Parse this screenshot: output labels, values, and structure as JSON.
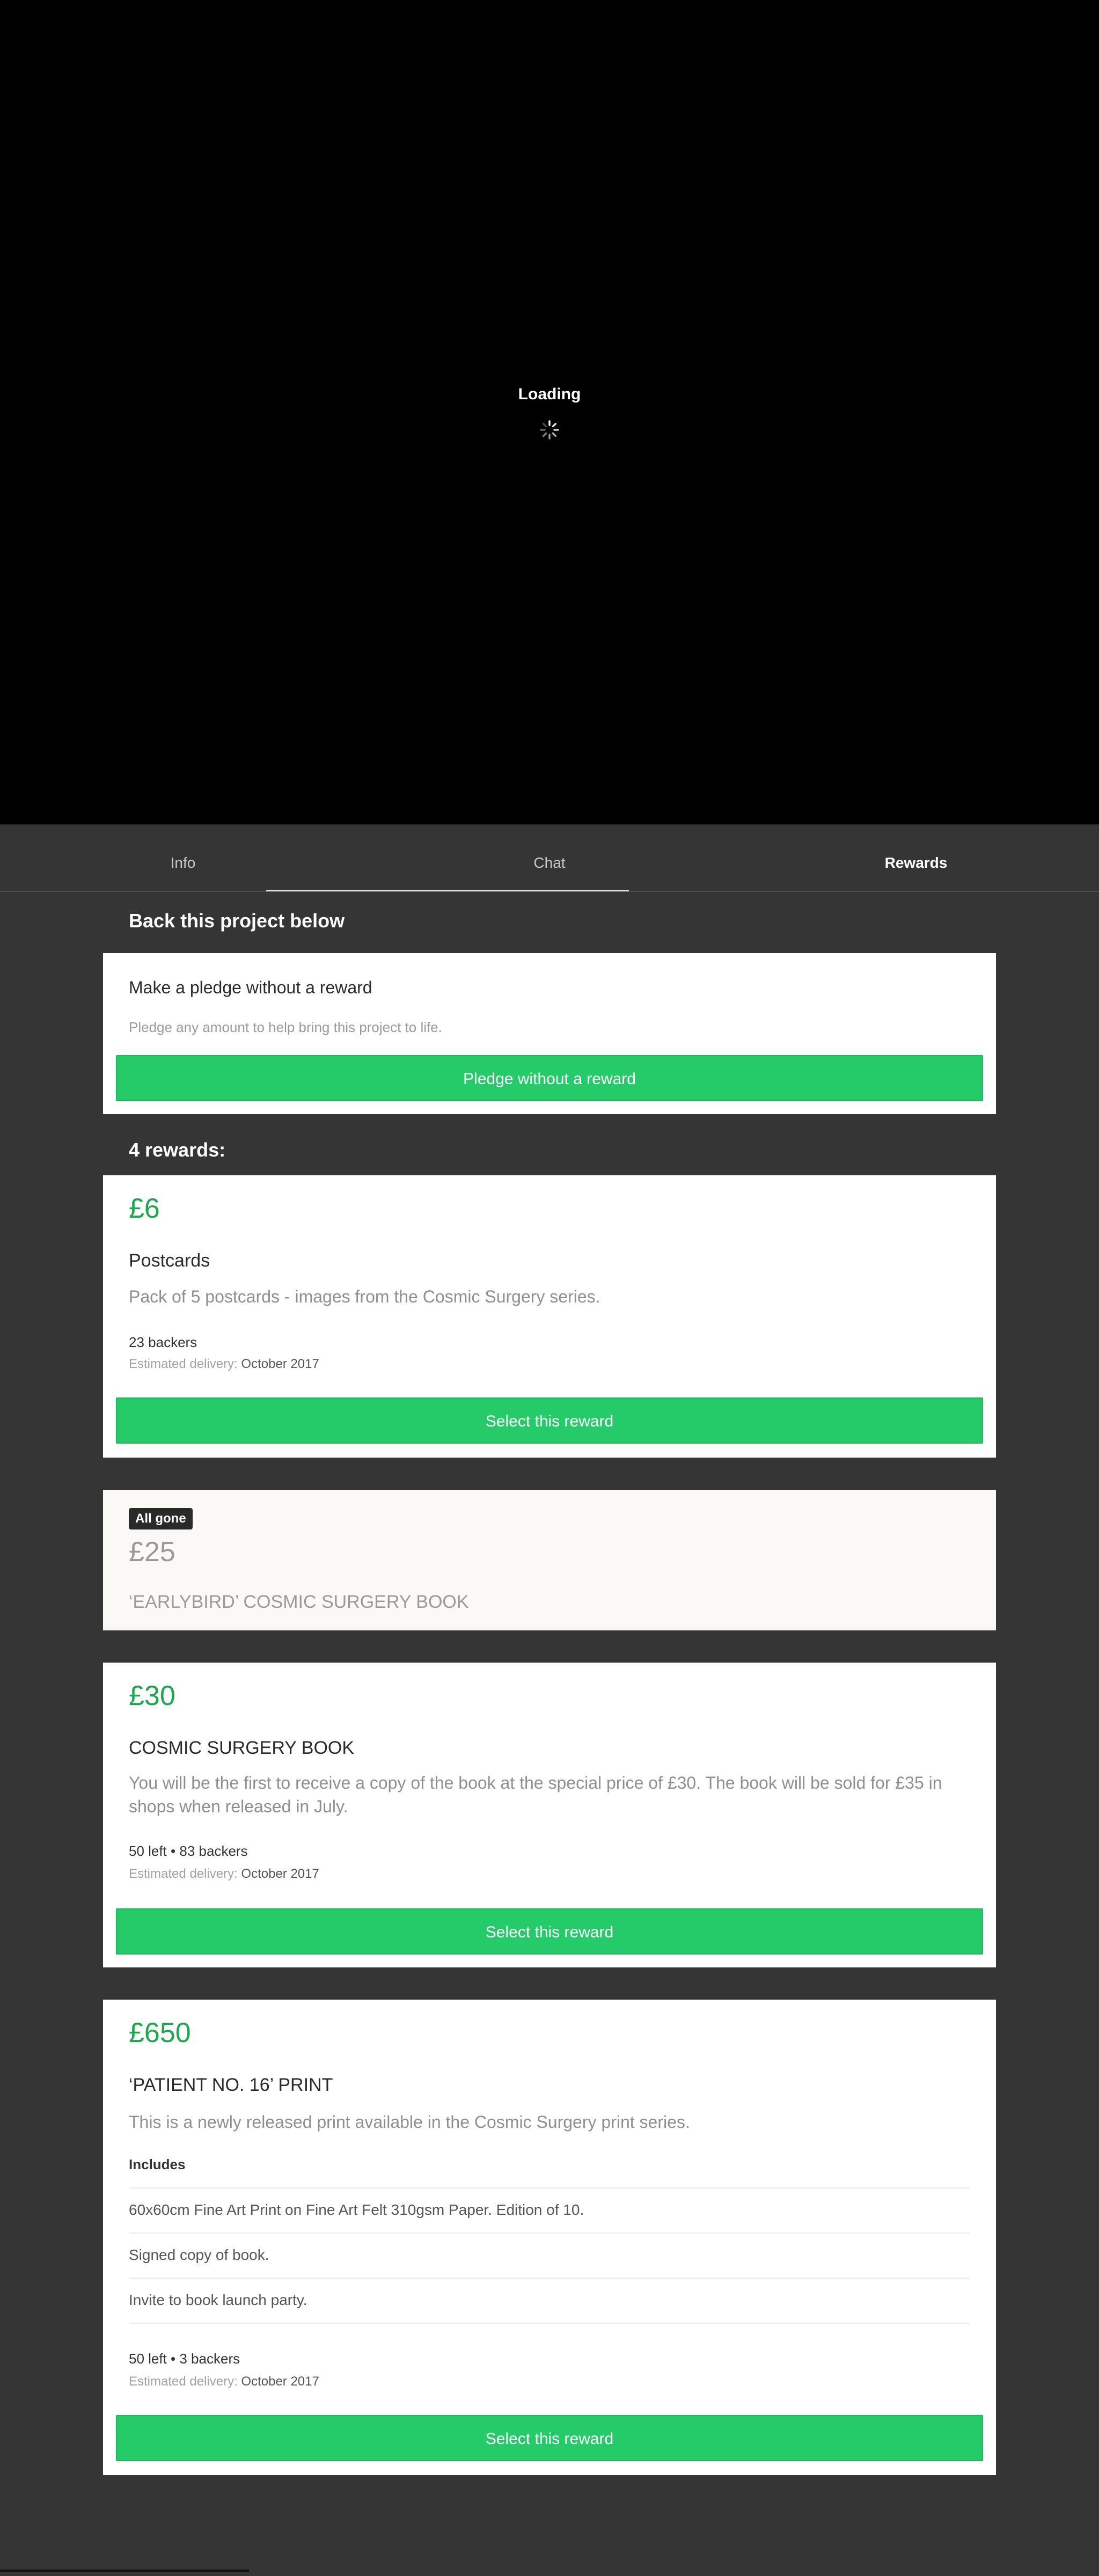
{
  "video": {
    "loading_text": "Loading"
  },
  "tabs": [
    {
      "label": "Info"
    },
    {
      "label": "Chat"
    },
    {
      "label": "Rewards"
    }
  ],
  "active_tab": "Rewards",
  "back_heading": "Back this project below",
  "no_reward": {
    "title": "Make a pledge without a reward",
    "description": "Pledge any amount to help bring this project to life.",
    "button_label": "Pledge without a reward"
  },
  "rewards_heading": "4 rewards:",
  "rewards": [
    {
      "price": "£6",
      "title": "Postcards",
      "description": "Pack of 5 postcards - images from the Cosmic Surgery series.",
      "stats": "23 backers",
      "delivery_label": "Estimated delivery:",
      "delivery_value": "October 2017",
      "button_label": "Select this reward"
    },
    {
      "badge": "All gone",
      "price": "£25",
      "title": "‘EARLYBIRD’ COSMIC SURGERY BOOK"
    },
    {
      "price": "£30",
      "title": "COSMIC SURGERY BOOK",
      "description": "You will be the first to receive a copy of the book at the special price of £30. The book will be sold for £35 in shops when released in July.",
      "stats": "50 left • 83 backers",
      "delivery_label": "Estimated delivery:",
      "delivery_value": "October 2017",
      "button_label": "Select this reward"
    },
    {
      "price": "£650",
      "title": "‘PATIENT NO. 16’ PRINT",
      "description": "This is a newly released print available in the Cosmic Surgery print series.",
      "includes_label": "Includes",
      "includes": [
        "60x60cm Fine Art Print on Fine Art Felt 310gsm Paper. Edition of 10.",
        "Signed copy of book.",
        "Invite to book launch party."
      ],
      "stats": "50 left • 3 backers",
      "delivery_label": "Estimated delivery:",
      "delivery_value": "October 2017",
      "button_label": "Select this reward"
    }
  ],
  "colors": {
    "accent_green": "#25cb68",
    "price_green": "#1ea84e",
    "background": "#353535"
  }
}
